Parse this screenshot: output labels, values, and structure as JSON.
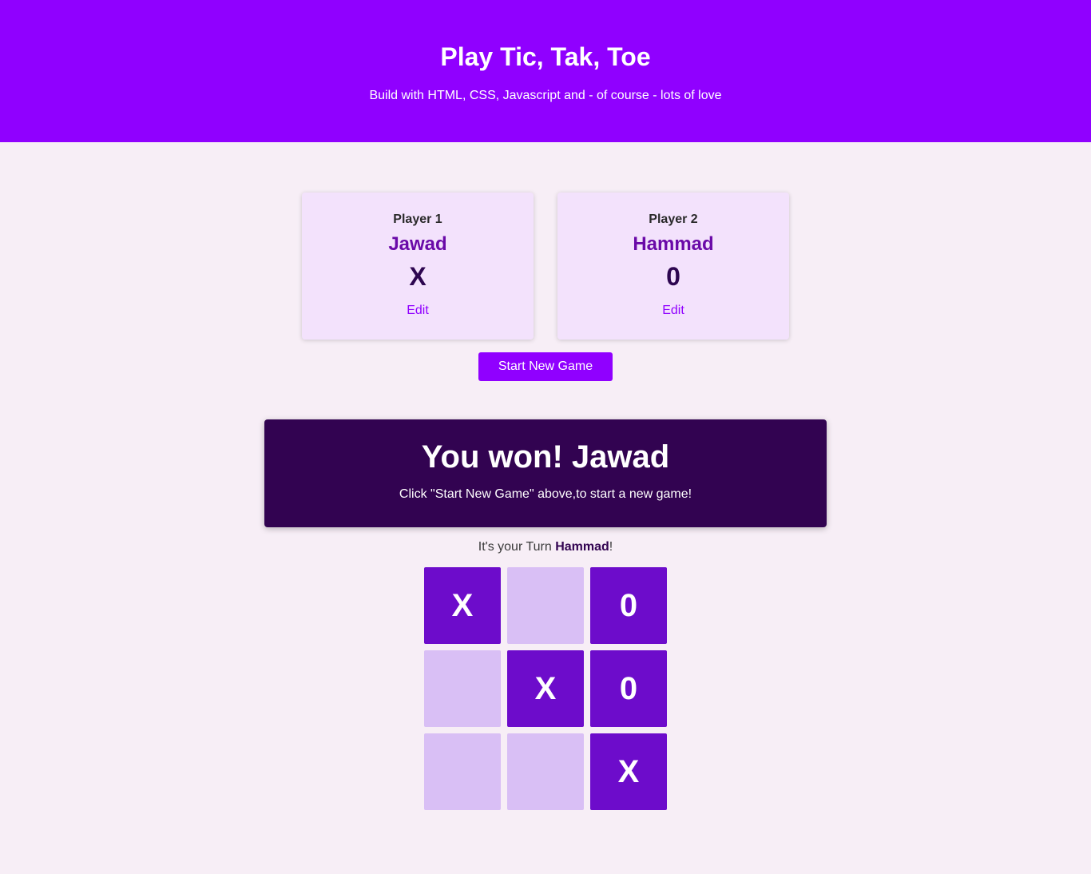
{
  "header": {
    "title": "Play Tic, Tak, Toe",
    "subtitle": "Build with HTML, CSS, Javascript and - of course - lots of love"
  },
  "players": [
    {
      "label": "Player 1",
      "name": "Jawad",
      "symbol": "X",
      "edit_label": "Edit"
    },
    {
      "label": "Player 2",
      "name": "Hammad",
      "symbol": "0",
      "edit_label": "Edit"
    }
  ],
  "start_button_label": "Start New Game",
  "game_over": {
    "title": "You won! Jawad",
    "message": "Click \"Start New Game\" above,to start a new game!"
  },
  "turn": {
    "prefix": "It's your Turn ",
    "player": "Hammad",
    "suffix": "!"
  },
  "board": [
    "X",
    "",
    "0",
    "",
    "X",
    "0",
    "",
    "",
    "X"
  ],
  "colors": {
    "primary": "#9000ff",
    "dark": "#320351",
    "cell_filled": "#6d0ccb",
    "cell_empty": "#d9bff5",
    "card_bg": "#f3e2fc",
    "page_bg": "#f7eef6"
  }
}
